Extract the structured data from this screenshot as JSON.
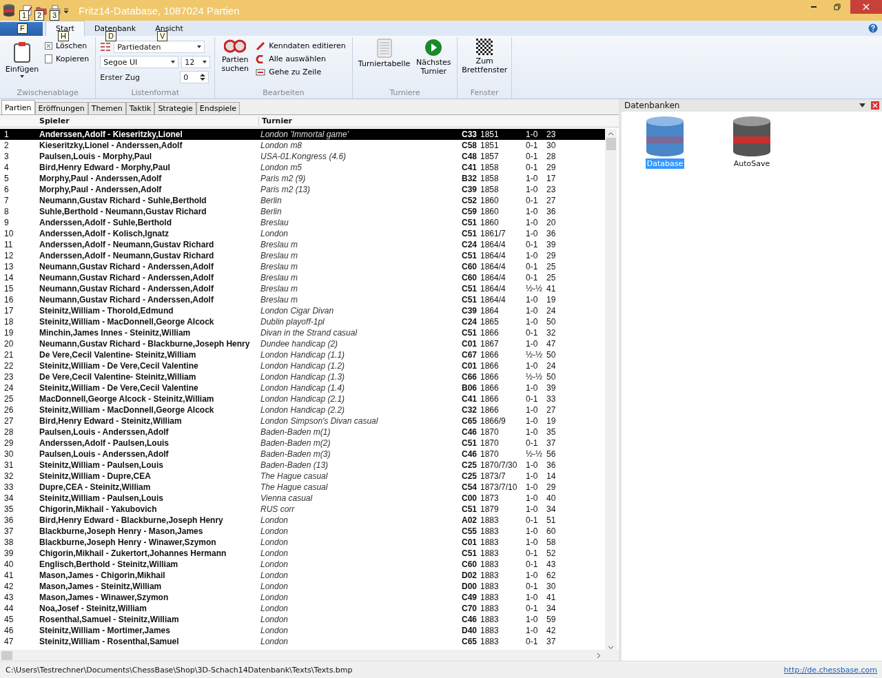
{
  "window": {
    "title": "Fritz14-Database,  1087024 Partien"
  },
  "quick_access_keytips": [
    "1",
    "2",
    "3"
  ],
  "file_tab": {
    "keytip": "F"
  },
  "ribbon_tabs": [
    {
      "label": "Start",
      "selected": true,
      "keytip": "H"
    },
    {
      "label": "Datenbank",
      "selected": false,
      "keytip": "D"
    },
    {
      "label": "Ansicht",
      "selected": false,
      "keytip": "V"
    }
  ],
  "clipboard": {
    "label": "Zwischenablage",
    "paste": "Einfügen",
    "delete": "Löschen",
    "copy": "Kopieren"
  },
  "list_format": {
    "label": "Listenformat",
    "format": "Partiedaten",
    "font": "Segoe UI",
    "size": "12",
    "first_move_label": "Erster Zug",
    "first_move": "0"
  },
  "edit": {
    "label": "Bearbeiten",
    "search": "Partien suchen",
    "actions": [
      "Kenndaten editieren",
      "Alle auswählen",
      "Gehe zu Zeile"
    ]
  },
  "tournaments": {
    "label": "Turniere",
    "buttons": [
      "Turniertabelle",
      "Nächstes Turnier"
    ]
  },
  "window_group": {
    "label": "Fenster",
    "button": "Zum Brettfenster"
  },
  "list_tabs": [
    {
      "label": "Partien",
      "selected": true
    },
    {
      "label": "Eröffnungen",
      "selected": false
    },
    {
      "label": "Themen",
      "selected": false
    },
    {
      "label": "Taktik",
      "selected": false
    },
    {
      "label": "Strategie",
      "selected": false
    },
    {
      "label": "Endspiele",
      "selected": false
    }
  ],
  "table": {
    "columns": [
      "Spieler",
      "Turnier"
    ],
    "rows": [
      {
        "n": "1",
        "players": "Anderssen,Adolf - Kieseritzky,Lionel",
        "event": "London 'Immortal game'",
        "eco": "C33",
        "year": "1851",
        "result": "1-0",
        "moves": "23",
        "selected": true
      },
      {
        "n": "2",
        "players": "Kieseritzky,Lionel - Anderssen,Adolf",
        "event": "London m8",
        "eco": "C58",
        "year": "1851",
        "result": "0-1",
        "moves": "30",
        "selected": false
      },
      {
        "n": "3",
        "players": "Paulsen,Louis - Morphy,Paul",
        "event": "USA-01.Kongress (4.6)",
        "eco": "C48",
        "year": "1857",
        "result": "0-1",
        "moves": "28",
        "selected": false
      },
      {
        "n": "4",
        "players": "Bird,Henry Edward - Morphy,Paul",
        "event": "London m5",
        "eco": "C41",
        "year": "1858",
        "result": "0-1",
        "moves": "29",
        "selected": false
      },
      {
        "n": "5",
        "players": "Morphy,Paul - Anderssen,Adolf",
        "event": "Paris m2 (9)",
        "eco": "B32",
        "year": "1858",
        "result": "1-0",
        "moves": "17",
        "selected": false
      },
      {
        "n": "6",
        "players": "Morphy,Paul - Anderssen,Adolf",
        "event": "Paris m2 (13)",
        "eco": "C39",
        "year": "1858",
        "result": "1-0",
        "moves": "23",
        "selected": false
      },
      {
        "n": "7",
        "players": "Neumann,Gustav Richard - Suhle,Berthold",
        "event": "Berlin",
        "eco": "C52",
        "year": "1860",
        "result": "0-1",
        "moves": "27",
        "selected": false
      },
      {
        "n": "8",
        "players": "Suhle,Berthold - Neumann,Gustav Richard",
        "event": "Berlin",
        "eco": "C59",
        "year": "1860",
        "result": "1-0",
        "moves": "36",
        "selected": false
      },
      {
        "n": "9",
        "players": "Anderssen,Adolf - Suhle,Berthold",
        "event": "Breslau",
        "eco": "C51",
        "year": "1860",
        "result": "1-0",
        "moves": "20",
        "selected": false
      },
      {
        "n": "10",
        "players": "Anderssen,Adolf - Kolisch,Ignatz",
        "event": "London",
        "eco": "C51",
        "year": "1861/7",
        "result": "1-0",
        "moves": "36",
        "selected": false
      },
      {
        "n": "11",
        "players": "Anderssen,Adolf - Neumann,Gustav Richard",
        "event": "Breslau m",
        "eco": "C24",
        "year": "1864/4",
        "result": "0-1",
        "moves": "39",
        "selected": false
      },
      {
        "n": "12",
        "players": "Anderssen,Adolf - Neumann,Gustav Richard",
        "event": "Breslau m",
        "eco": "C51",
        "year": "1864/4",
        "result": "1-0",
        "moves": "29",
        "selected": false
      },
      {
        "n": "13",
        "players": "Neumann,Gustav Richard - Anderssen,Adolf",
        "event": "Breslau m",
        "eco": "C60",
        "year": "1864/4",
        "result": "0-1",
        "moves": "25",
        "selected": false
      },
      {
        "n": "14",
        "players": "Neumann,Gustav Richard - Anderssen,Adolf",
        "event": "Breslau m",
        "eco": "C60",
        "year": "1864/4",
        "result": "0-1",
        "moves": "25",
        "selected": false
      },
      {
        "n": "15",
        "players": "Neumann,Gustav Richard - Anderssen,Adolf",
        "event": "Breslau m",
        "eco": "C51",
        "year": "1864/4",
        "result": "½-½",
        "moves": "41",
        "selected": false
      },
      {
        "n": "16",
        "players": "Neumann,Gustav Richard - Anderssen,Adolf",
        "event": "Breslau m",
        "eco": "C51",
        "year": "1864/4",
        "result": "1-0",
        "moves": "19",
        "selected": false
      },
      {
        "n": "17",
        "players": "Steinitz,William - Thorold,Edmund",
        "event": "London Cigar Divan",
        "eco": "C39",
        "year": "1864",
        "result": "1-0",
        "moves": "24",
        "selected": false
      },
      {
        "n": "18",
        "players": "Steinitz,William - MacDonnell,George Alcock",
        "event": "Dublin playoff-1pl",
        "eco": "C24",
        "year": "1865",
        "result": "1-0",
        "moves": "50",
        "selected": false
      },
      {
        "n": "19",
        "players": "Minchin,James Innes - Steinitz,William",
        "event": "Divan in the Strand casual",
        "eco": "C51",
        "year": "1866",
        "result": "0-1",
        "moves": "32",
        "selected": false
      },
      {
        "n": "20",
        "players": "Neumann,Gustav Richard - Blackburne,Joseph Henry",
        "event": "Dundee handicap (2)",
        "eco": "C01",
        "year": "1867",
        "result": "1-0",
        "moves": "47",
        "selected": false
      },
      {
        "n": "21",
        "players": "De Vere,Cecil Valentine- Steinitz,William",
        "event": "London Handicap (1.1)",
        "eco": "C67",
        "year": "1866",
        "result": "½-½",
        "moves": "50",
        "selected": false
      },
      {
        "n": "22",
        "players": "Steinitz,William - De Vere,Cecil Valentine",
        "event": "London Handicap (1.2)",
        "eco": "C01",
        "year": "1866",
        "result": "1-0",
        "moves": "24",
        "selected": false
      },
      {
        "n": "23",
        "players": "De Vere,Cecil Valentine- Steinitz,William",
        "event": "London Handicap (1.3)",
        "eco": "C66",
        "year": "1866",
        "result": "½-½",
        "moves": "50",
        "selected": false
      },
      {
        "n": "24",
        "players": "Steinitz,William - De Vere,Cecil Valentine",
        "event": "London Handicap (1.4)",
        "eco": "B06",
        "year": "1866",
        "result": "1-0",
        "moves": "39",
        "selected": false
      },
      {
        "n": "25",
        "players": "MacDonnell,George Alcock - Steinitz,William",
        "event": "London Handicap (2.1)",
        "eco": "C41",
        "year": "1866",
        "result": "0-1",
        "moves": "33",
        "selected": false
      },
      {
        "n": "26",
        "players": "Steinitz,William - MacDonnell,George Alcock",
        "event": "London Handicap (2.2)",
        "eco": "C32",
        "year": "1866",
        "result": "1-0",
        "moves": "27",
        "selected": false
      },
      {
        "n": "27",
        "players": "Bird,Henry Edward - Steinitz,William",
        "event": "London Simpson's Divan casual",
        "eco": "C65",
        "year": "1866/9",
        "result": "1-0",
        "moves": "19",
        "selected": false
      },
      {
        "n": "28",
        "players": "Paulsen,Louis - Anderssen,Adolf",
        "event": "Baden-Baden m(1)",
        "eco": "C46",
        "year": "1870",
        "result": "1-0",
        "moves": "35",
        "selected": false
      },
      {
        "n": "29",
        "players": "Anderssen,Adolf - Paulsen,Louis",
        "event": "Baden-Baden m(2)",
        "eco": "C51",
        "year": "1870",
        "result": "0-1",
        "moves": "37",
        "selected": false
      },
      {
        "n": "30",
        "players": "Paulsen,Louis - Anderssen,Adolf",
        "event": "Baden-Baden m(3)",
        "eco": "C46",
        "year": "1870",
        "result": "½-½",
        "moves": "56",
        "selected": false
      },
      {
        "n": "31",
        "players": "Steinitz,William - Paulsen,Louis",
        "event": "Baden-Baden (13)",
        "eco": "C25",
        "year": "1870/7/30",
        "result": "1-0",
        "moves": "36",
        "selected": false
      },
      {
        "n": "32",
        "players": "Steinitz,William - Dupre,CEA",
        "event": "The Hague casual",
        "eco": "C25",
        "year": "1873/7",
        "result": "1-0",
        "moves": "14",
        "selected": false
      },
      {
        "n": "33",
        "players": "Dupre,CEA - Steinitz,William",
        "event": "The Hague casual",
        "eco": "C54",
        "year": "1873/7/10",
        "result": "1-0",
        "moves": "29",
        "selected": false
      },
      {
        "n": "34",
        "players": "Steinitz,William - Paulsen,Louis",
        "event": "Vienna casual",
        "eco": "C00",
        "year": "1873",
        "result": "1-0",
        "moves": "40",
        "selected": false
      },
      {
        "n": "35",
        "players": "Chigorin,Mikhail - Yakubovich",
        "event": "RUS corr",
        "eco": "C51",
        "year": "1879",
        "result": "1-0",
        "moves": "34",
        "selected": false
      },
      {
        "n": "36",
        "players": "Bird,Henry Edward - Blackburne,Joseph Henry",
        "event": "London",
        "eco": "A02",
        "year": "1883",
        "result": "0-1",
        "moves": "51",
        "selected": false
      },
      {
        "n": "37",
        "players": "Blackburne,Joseph Henry - Mason,James",
        "event": "London",
        "eco": "C55",
        "year": "1883",
        "result": "1-0",
        "moves": "60",
        "selected": false
      },
      {
        "n": "38",
        "players": "Blackburne,Joseph Henry - Winawer,Szymon",
        "event": "London",
        "eco": "C01",
        "year": "1883",
        "result": "1-0",
        "moves": "58",
        "selected": false
      },
      {
        "n": "39",
        "players": "Chigorin,Mikhail - Zukertort,Johannes Hermann",
        "event": "London",
        "eco": "C51",
        "year": "1883",
        "result": "0-1",
        "moves": "52",
        "selected": false
      },
      {
        "n": "40",
        "players": "Englisch,Berthold - Steinitz,William",
        "event": "London",
        "eco": "C60",
        "year": "1883",
        "result": "0-1",
        "moves": "43",
        "selected": false
      },
      {
        "n": "41",
        "players": "Mason,James - Chigorin,Mikhail",
        "event": "London",
        "eco": "D02",
        "year": "1883",
        "result": "1-0",
        "moves": "62",
        "selected": false
      },
      {
        "n": "42",
        "players": "Mason,James - Steinitz,William",
        "event": "London",
        "eco": "D00",
        "year": "1883",
        "result": "0-1",
        "moves": "30",
        "selected": false
      },
      {
        "n": "43",
        "players": "Mason,James - Winawer,Szymon",
        "event": "London",
        "eco": "C49",
        "year": "1883",
        "result": "1-0",
        "moves": "41",
        "selected": false
      },
      {
        "n": "44",
        "players": "Noa,Josef - Steinitz,William",
        "event": "London",
        "eco": "C70",
        "year": "1883",
        "result": "0-1",
        "moves": "34",
        "selected": false
      },
      {
        "n": "45",
        "players": "Rosenthal,Samuel - Steinitz,William",
        "event": "London",
        "eco": "C46",
        "year": "1883",
        "result": "1-0",
        "moves": "59",
        "selected": false
      },
      {
        "n": "46",
        "players": "Steinitz,William - Mortimer,James",
        "event": "London",
        "eco": "D40",
        "year": "1883",
        "result": "1-0",
        "moves": "42",
        "selected": false
      },
      {
        "n": "47",
        "players": "Steinitz,William - Rosenthal,Samuel",
        "event": "London",
        "eco": "C65",
        "year": "1883",
        "result": "0-1",
        "moves": "37",
        "selected": false
      }
    ]
  },
  "databases_panel": {
    "title": "Datenbanken",
    "items": [
      {
        "label": "Database",
        "kind": "blue",
        "selected": true
      },
      {
        "label": "AutoSave",
        "kind": "red",
        "selected": false
      }
    ]
  },
  "status_bar": {
    "path": "C:\\Users\\Testrechner\\Documents\\ChessBase\\Shop\\3D-Schach14Datenbank\\Texts\\Texts.bmp",
    "link": "http://de.chessbase.com"
  }
}
